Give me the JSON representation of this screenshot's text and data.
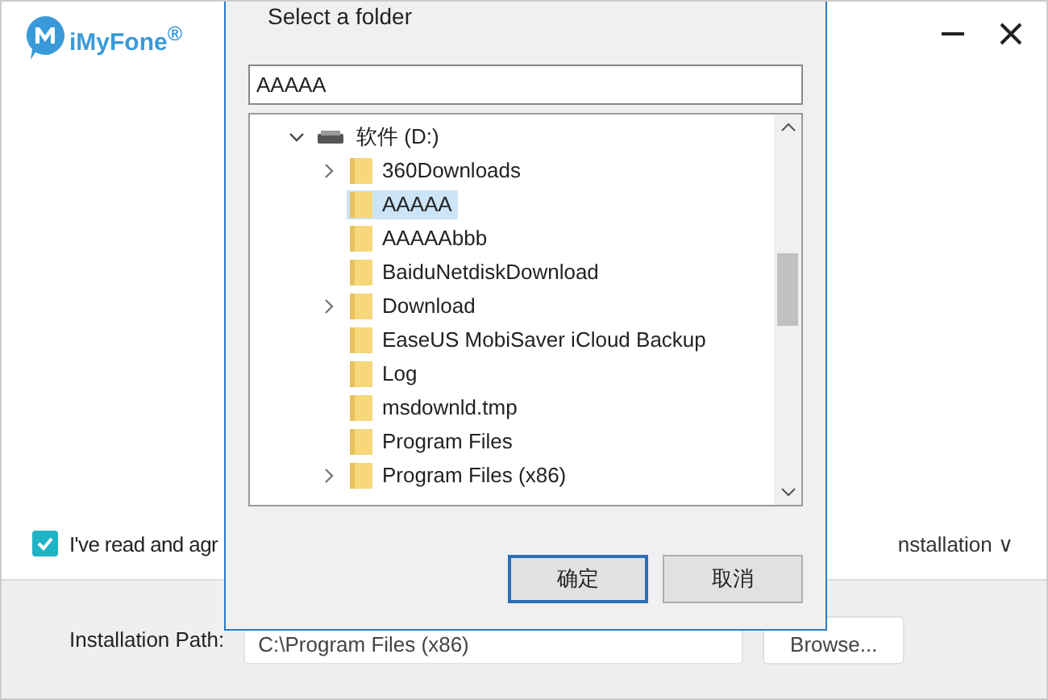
{
  "installer": {
    "logo": "iMyFone$^{®}$",
    "agreement": {
      "checked": true,
      "text": "I've read and agr"
    },
    "options_link": "nstallation ∨",
    "path_label": "Installation Path:",
    "path_value": "C:\\Program Files (x86)",
    "browse": "Browse..."
  },
  "dialog": {
    "title": "Select a folder",
    "folder_field": "AAAAA",
    "tree": [
      {
        "label": "软件 (D:)",
        "expanded": true,
        "children": [
          {
            "label": "360Downloads",
            "has_children": true,
            "selected": false
          },
          {
            "label": "AAAAA",
            "has_children": false,
            "selected": true
          },
          {
            "label": "AAAAAbbb",
            "has_children": false,
            "selected": false
          },
          {
            "label": "BaiduNetdiskDownload",
            "has_children": false,
            "selected": false
          },
          {
            "label": "Download",
            "has_children": true,
            "selected": false
          },
          {
            "label": "EaseUS MobiSaver iCloud Backup",
            "has_children": false,
            "selected": false
          },
          {
            "label": "Log",
            "has_children": false,
            "selected": false
          },
          {
            "label": "msdownld.tmp",
            "has_children": false,
            "selected": false
          },
          {
            "label": "Program Files",
            "has_children": false,
            "selected": false
          },
          {
            "label": "Program Files (x86)",
            "has_children": true,
            "selected": false
          }
        ]
      }
    ],
    "buttons": [
      {
        "label": "确定",
        "default": true
      },
      {
        "label": "取消",
        "default": false
      }
    ]
  }
}
